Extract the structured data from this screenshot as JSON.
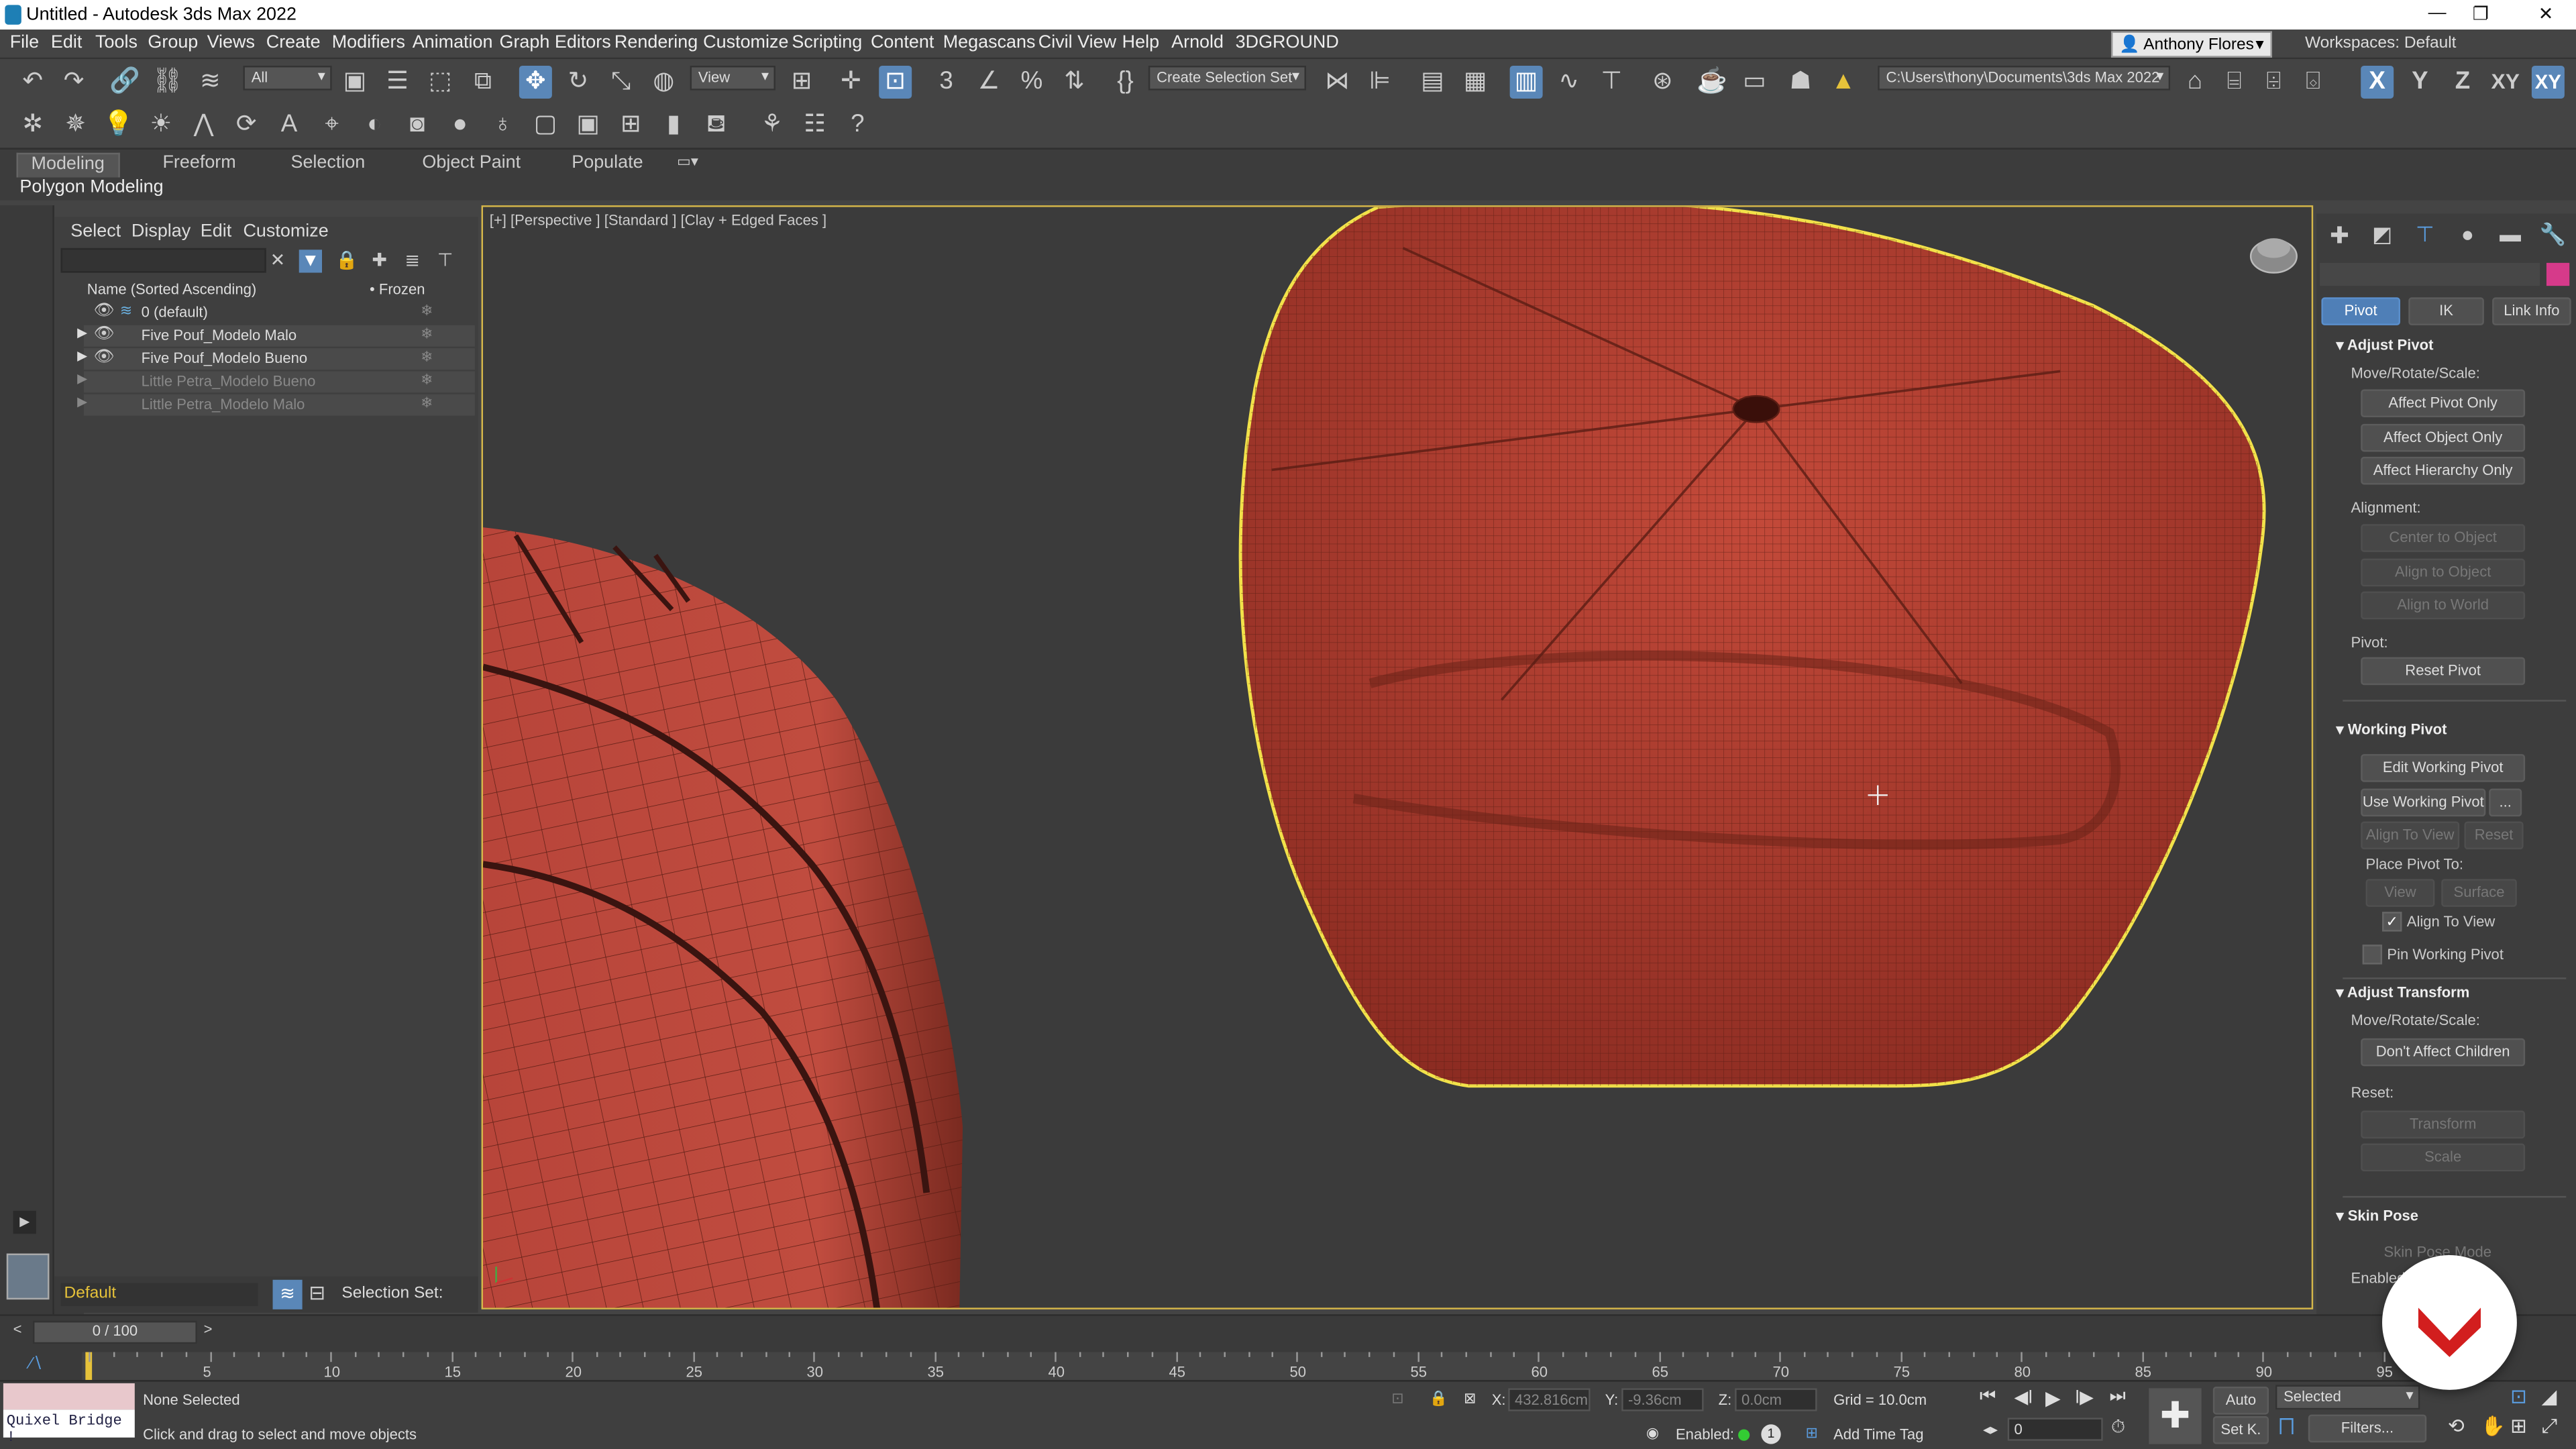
{
  "window": {
    "title": "Untitled - Autodesk 3ds Max 2022"
  },
  "menu": [
    "File",
    "Edit",
    "Tools",
    "Group",
    "Views",
    "Create",
    "Modifiers",
    "Animation",
    "Graph Editors",
    "Rendering",
    "Customize",
    "Scripting",
    "Content",
    "Megascans",
    "Civil View",
    "Help",
    "Arnold",
    "3DGROUND"
  ],
  "user": {
    "name": "Anthony Flores"
  },
  "workspace": {
    "label": "Workspaces:",
    "value": "Default"
  },
  "toolbar": {
    "filter_value": "All",
    "refcoord_value": "View",
    "selection_set": "Create Selection Set",
    "project_path": "C:\\Users\\thony\\Documents\\3ds Max 2022",
    "axis_x": "X",
    "axis_y": "Y",
    "axis_z": "Z",
    "axis_xy": "XY",
    "axis_xyz": "XY"
  },
  "ribbon": {
    "tabs": [
      "Modeling",
      "Freeform",
      "Selection",
      "Object Paint",
      "Populate"
    ],
    "active_panel": "Polygon Modeling"
  },
  "explorer": {
    "menu": [
      "Select",
      "Display",
      "Edit",
      "Customize"
    ],
    "header_name": "Name (Sorted Ascending)",
    "header_frozen": "• Frozen",
    "rows": [
      {
        "name": "0 (default)",
        "state": "normal"
      },
      {
        "name": "Five Pouf_Modelo Malo",
        "state": "normal"
      },
      {
        "name": "Five Pouf_Modelo Bueno",
        "state": "normal"
      },
      {
        "name": "Little Petra_Modelo Bueno",
        "state": "hidden"
      },
      {
        "name": "Little Petra_Modelo Malo",
        "state": "hidden"
      }
    ],
    "layer_value": "Default",
    "selection_set_label": "Selection Set:"
  },
  "viewport": {
    "label": "[+] [Perspective ] [Standard ] [Clay + Edged Faces ]"
  },
  "command_panel": {
    "tabs": {
      "pivot": "Pivot",
      "ik": "IK",
      "link_info": "Link Info"
    },
    "adjust_pivot": {
      "title": "Adjust Pivot",
      "move_label": "Move/Rotate/Scale:",
      "affect_pivot": "Affect Pivot Only",
      "affect_object": "Affect Object Only",
      "affect_hierarchy": "Affect Hierarchy Only",
      "alignment_label": "Alignment:",
      "center_to_object": "Center to Object",
      "align_to_object": "Align to Object",
      "align_to_world": "Align to World",
      "pivot_label": "Pivot:",
      "reset_pivot": "Reset Pivot"
    },
    "working_pivot": {
      "title": "Working Pivot",
      "edit": "Edit Working Pivot",
      "use": "Use Working Pivot",
      "more": "...",
      "align_to_view_btn": "Align To View",
      "reset": "Reset",
      "place_label": "Place Pivot To:",
      "view": "View",
      "surface": "Surface",
      "align_to_view_chk": "Align To View",
      "pin": "Pin Working Pivot"
    },
    "adjust_transform": {
      "title": "Adjust Transform",
      "move_label": "Move/Rotate/Scale:",
      "dont_affect": "Don't Affect Children",
      "reset_label": "Reset:",
      "transform": "Transform",
      "scale": "Scale"
    },
    "skin_pose": {
      "title": "Skin Pose",
      "mode": "Skin Pose Mode",
      "enabled": "Enabled"
    },
    "accent_color": "#d63a8a"
  },
  "timeline": {
    "slider": "0 / 100",
    "ticks": [
      "5",
      "10",
      "15",
      "20",
      "25",
      "30",
      "35",
      "40",
      "45",
      "50",
      "55",
      "60",
      "65",
      "70",
      "75",
      "80",
      "85",
      "90",
      "95"
    ]
  },
  "status": {
    "quixel": "Quixel Bridge !",
    "selection": "None Selected",
    "prompt": "Click and drag to select and move objects",
    "x_label": "X:",
    "x_value": "432.816cm",
    "y_label": "Y:",
    "y_value": "-9.36cm",
    "z_label": "Z:",
    "z_value": "0.0cm",
    "grid": "Grid = 10.0cm",
    "enabled": "Enabled:",
    "add_time_tag": "Add Time Tag",
    "auto": "Auto",
    "set_key": "Set K.",
    "key_filter": "Selected",
    "filters": "Filters...",
    "frame": "0"
  }
}
